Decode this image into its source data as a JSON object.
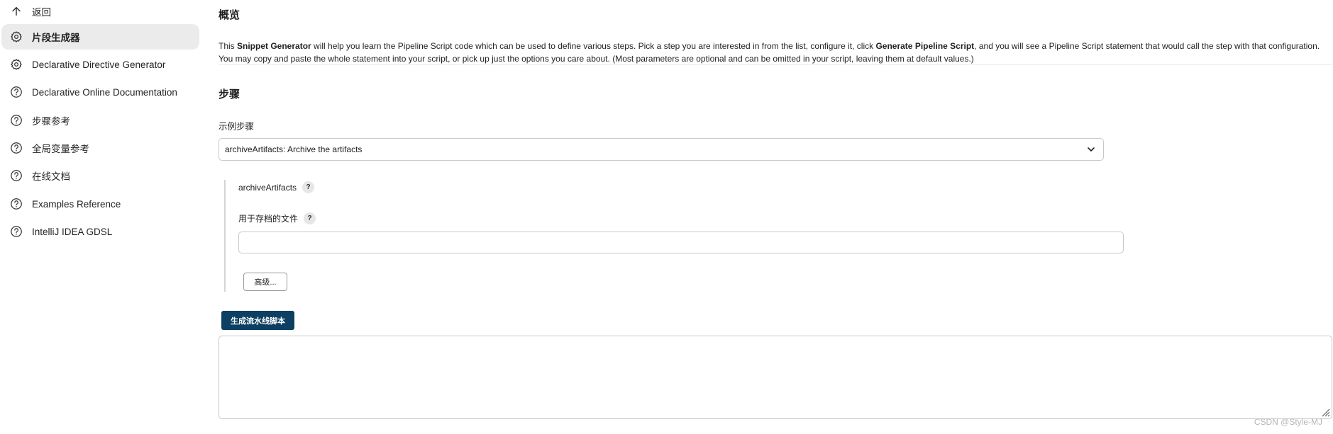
{
  "sidebar": {
    "items": [
      {
        "label": "返回",
        "icon": "arrow-up-icon"
      },
      {
        "label": "片段生成器",
        "icon": "gear-icon",
        "active": true
      },
      {
        "label": "Declarative Directive Generator",
        "icon": "gear-icon"
      },
      {
        "label": "Declarative Online Documentation",
        "icon": "help-circle-icon"
      },
      {
        "label": "步骤参考",
        "icon": "help-circle-icon"
      },
      {
        "label": "全局变量参考",
        "icon": "help-circle-icon"
      },
      {
        "label": "在线文档",
        "icon": "help-circle-icon"
      },
      {
        "label": "Examples Reference",
        "icon": "help-circle-icon"
      },
      {
        "label": "IntelliJ IDEA GDSL",
        "icon": "help-circle-icon"
      }
    ]
  },
  "main": {
    "overview_title": "概览",
    "description": {
      "p1": "This ",
      "b1": "Snippet Generator",
      "p2": " will help you learn the Pipeline Script code which can be used to define various steps. Pick a step you are interested in from the list, configure it, click ",
      "b2": "Generate Pipeline Script",
      "p3": ", and you will see a Pipeline Script statement that would call the step with that configuration. You may copy and paste the whole statement into your script, or pick up just the options you care about. (Most parameters are optional and can be omitted in your script, leaving them at default values.)"
    },
    "steps_title": "步骤",
    "sample_step_label": "示例步骤",
    "sample_step_value": "archiveArtifacts: Archive the artifacts",
    "config": {
      "step_name": "archiveArtifacts",
      "help_glyph": "?",
      "files_label": "用于存档的文件",
      "files_value": "",
      "advanced_button": "高级..."
    },
    "generate_button": "生成流水线脚本",
    "output_value": ""
  },
  "watermark": "CSDN @Style-MJ",
  "colors": {
    "primary_button": "#0d3f63",
    "active_item_bg": "#ebebeb"
  }
}
